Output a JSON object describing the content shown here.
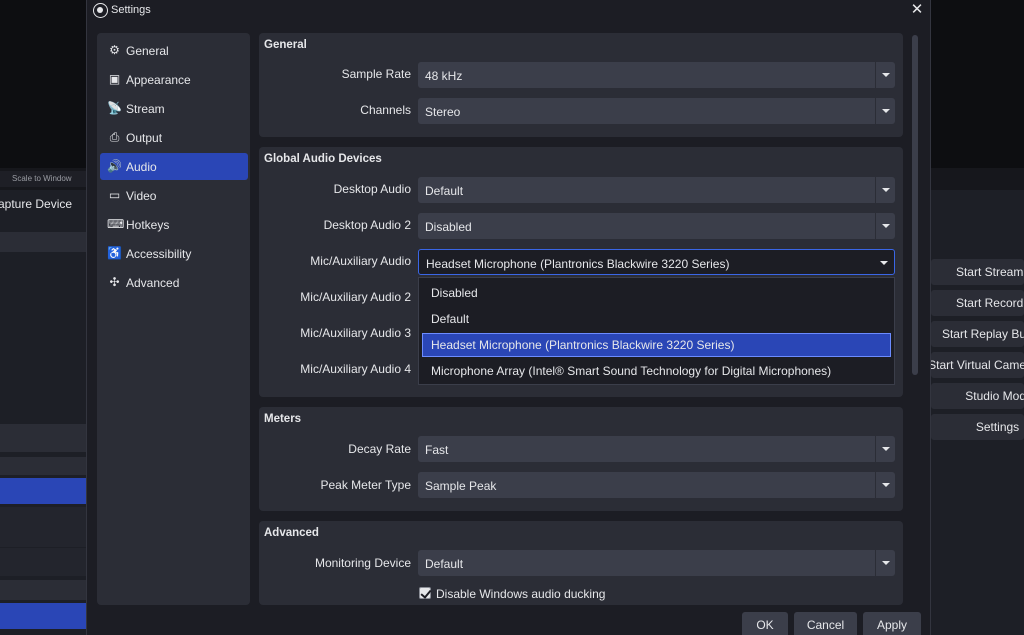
{
  "background": {
    "scale_label": "Scale to Window",
    "capture_label": "apture Device",
    "right_buttons": [
      "Start Streami",
      "Start Recordi",
      "Start Replay Bu",
      "Start Virtual Came",
      "Studio Mod",
      "Settings"
    ]
  },
  "dialog": {
    "title": "Settings",
    "close_glyph": "✕"
  },
  "sidebar": {
    "items": [
      {
        "label": "General",
        "icon": "⚙"
      },
      {
        "label": "Appearance",
        "icon": "▣"
      },
      {
        "label": "Stream",
        "icon": "📡"
      },
      {
        "label": "Output",
        "icon": "⎙"
      },
      {
        "label": "Audio",
        "icon": "🔊"
      },
      {
        "label": "Video",
        "icon": "▭"
      },
      {
        "label": "Hotkeys",
        "icon": "⌨"
      },
      {
        "label": "Accessibility",
        "icon": "♿"
      },
      {
        "label": "Advanced",
        "icon": "✣"
      }
    ]
  },
  "general": {
    "title": "General",
    "sample_rate_label": "Sample Rate",
    "sample_rate_value": "48 kHz",
    "channels_label": "Channels",
    "channels_value": "Stereo"
  },
  "global_audio": {
    "title": "Global Audio Devices",
    "desktop_audio_label": "Desktop Audio",
    "desktop_audio_value": "Default",
    "desktop_audio2_label": "Desktop Audio 2",
    "desktop_audio2_value": "Disabled",
    "mic_label": "Mic/Auxiliary Audio",
    "mic_value": "Headset Microphone (Plantronics Blackwire 3220 Series)",
    "mic2_label": "Mic/Auxiliary Audio 2",
    "mic3_label": "Mic/Auxiliary Audio 3",
    "mic4_label": "Mic/Auxiliary Audio 4",
    "dropdown_options": [
      "Disabled",
      "Default",
      "Headset Microphone (Plantronics Blackwire 3220 Series)",
      "Microphone Array (Intel® Smart Sound Technology for Digital Microphones)"
    ],
    "selected_option": "Headset Microphone (Plantronics Blackwire 3220 Series)"
  },
  "meters": {
    "title": "Meters",
    "decay_rate_label": "Decay Rate",
    "decay_rate_value": "Fast",
    "peak_meter_label": "Peak Meter Type",
    "peak_meter_value": "Sample Peak"
  },
  "advanced": {
    "title": "Advanced",
    "monitoring_label": "Monitoring Device",
    "monitoring_value": "Default",
    "ducking_label": "Disable Windows audio ducking",
    "ducking_checked": true
  },
  "footer": {
    "ok": "OK",
    "cancel": "Cancel",
    "apply": "Apply"
  },
  "colors": {
    "accent": "#2a46b6",
    "panel": "#2b2d36",
    "dialog_bg": "#1c1d24"
  }
}
